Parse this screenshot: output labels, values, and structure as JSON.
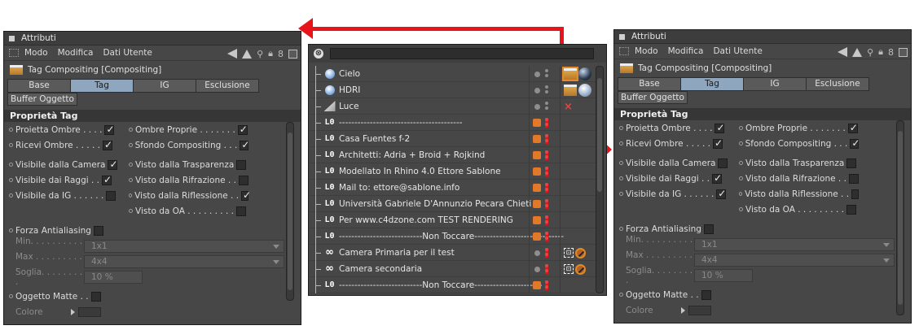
{
  "colors": {
    "panel_bg": "#474747",
    "tab_active": "#8fa6bf",
    "annotation": "#e8141c",
    "orange_flag": "#e2782a"
  },
  "left_panel": {
    "title": "Attributi",
    "menu": [
      "Modo",
      "Modifica",
      "Dati Utente"
    ],
    "object_title": "Tag Compositing [Compositing]",
    "tabs": [
      "Base",
      "Tag",
      "IG",
      "Esclusione"
    ],
    "active_tab": "Tag",
    "tab2": "Buffer Oggetto",
    "section": "Proprietà Tag",
    "rows": [
      [
        "Proietta Ombre . . . . ",
        "Ombre Proprie . . . . . . ."
      ],
      [
        "Ricevi Ombre . . . . .",
        "Sfondo Compositing . . ."
      ],
      [
        "Visibile dalla Camera",
        "Visto dalla Trasparenza"
      ],
      [
        "Visibile dai Raggi . .",
        "Visto dalla Rifrazione . ."
      ],
      [
        "Visibile da IG . . . . . .",
        "Visto dalla Riflessione . ."
      ],
      [
        "",
        "Visto da OA . . . . . . . . ."
      ]
    ],
    "forza": "Forza Antialiasing",
    "min_label": "Min. . . . . . . . . . .",
    "min_value": "1x1",
    "max_label": "Max . . . . . . . . . .",
    "max_value": "4x4",
    "soglia_label": "Soglia. . . . . . . . .",
    "soglia_value": "10 %",
    "matte": "Oggetto Matte . .",
    "colore": "Colore"
  },
  "right_panel": {
    "title": "Attributi",
    "menu": [
      "Modo",
      "Modifica",
      "Dati Utente"
    ],
    "object_title": "Tag Compositing [Compositing]",
    "tabs": [
      "Base",
      "Tag",
      "IG",
      "Esclusione"
    ],
    "tab2": "Buffer Oggetto",
    "section": "Proprietà Tag",
    "rows": [
      [
        "Proietta Ombre . . . . ",
        "Ombre Proprie . . . . . . ."
      ],
      [
        "Ricevi Ombre . . . . .",
        "Sfondo Compositing . . ."
      ],
      [
        "Visibile dalla Camera",
        "Visto dalla Trasparenza"
      ],
      [
        "Visibile dai Raggi . .",
        "Visto dalla Rifrazione . ."
      ],
      [
        "Visibile da IG . . . . . .",
        "Visto dalla Riflessione . ."
      ],
      [
        "",
        "Visto da OA . . . . . . . . ."
      ]
    ],
    "forza": "Forza Antialiasing",
    "min_label": "Min. . . . . . . . . . .",
    "min_value": "1x1",
    "max_label": "Max . . . . . . . . . .",
    "max_value": "4x4",
    "soglia_label": "Soglia. . . . . . . . .",
    "soglia_value": "10 %",
    "matte": "Oggetto Matte . .",
    "colore": "Colore"
  },
  "object_manager": {
    "objects": [
      {
        "name": "Cielo",
        "icon": "sky-icon"
      },
      {
        "name": "HDRI",
        "icon": "sky-icon"
      },
      {
        "name": "Luce",
        "icon": "light-icon"
      },
      {
        "name": "----------------------------------------",
        "icon": "null-icon"
      },
      {
        "name": "Casa Fuentes  f-2",
        "icon": "null-icon"
      },
      {
        "name": "Architetti: Adria + Broid + Rojkind",
        "icon": "null-icon"
      },
      {
        "name": "Modellato In Rhino 4.0  Ettore Sablone",
        "icon": "null-icon"
      },
      {
        "name": "Mail to: ettore@sablone.info",
        "icon": "null-icon"
      },
      {
        "name": "Università  Gabriele D'Annunzio Pecara Chieti",
        "icon": "null-icon"
      },
      {
        "name": "Per www.c4dzone.com TEST RENDERING",
        "icon": "null-icon"
      },
      {
        "name": "---------------------------Non Toccare-----------------------------",
        "icon": "null-icon"
      },
      {
        "name": "Camera Primaria per il test",
        "icon": "camera-icon"
      },
      {
        "name": "Camera secondaria",
        "icon": "camera-icon"
      },
      {
        "name": "---------------------------Non Toccare----------------------",
        "icon": "null-icon"
      }
    ]
  }
}
